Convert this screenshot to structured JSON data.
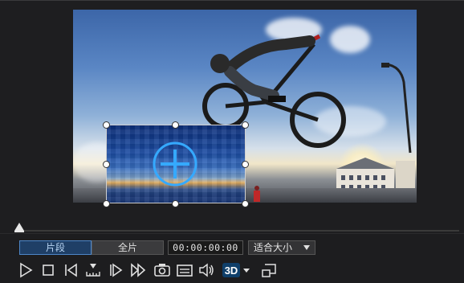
{
  "preview": {
    "description_hidden": true
  },
  "toolbar": {
    "segment_clip_label": "片段",
    "segment_full_label": "全片",
    "timecode": "00:00:00:00",
    "fit_label": "适合大小",
    "threed_label": "3D"
  },
  "colors": {
    "accent": "#4d86c8",
    "background": "#1b1b1d"
  },
  "icons": {
    "play": "play-icon",
    "stop": "stop-icon",
    "prev_frame": "previous-frame-icon",
    "step": "step-icon",
    "next_frame": "next-frame-icon",
    "fast_forward": "fast-forward-icon",
    "snapshot": "camera-icon",
    "subtitles": "subtitle-icon",
    "volume": "volume-icon",
    "threed": "3d-icon",
    "pip": "pip-window-icon"
  }
}
